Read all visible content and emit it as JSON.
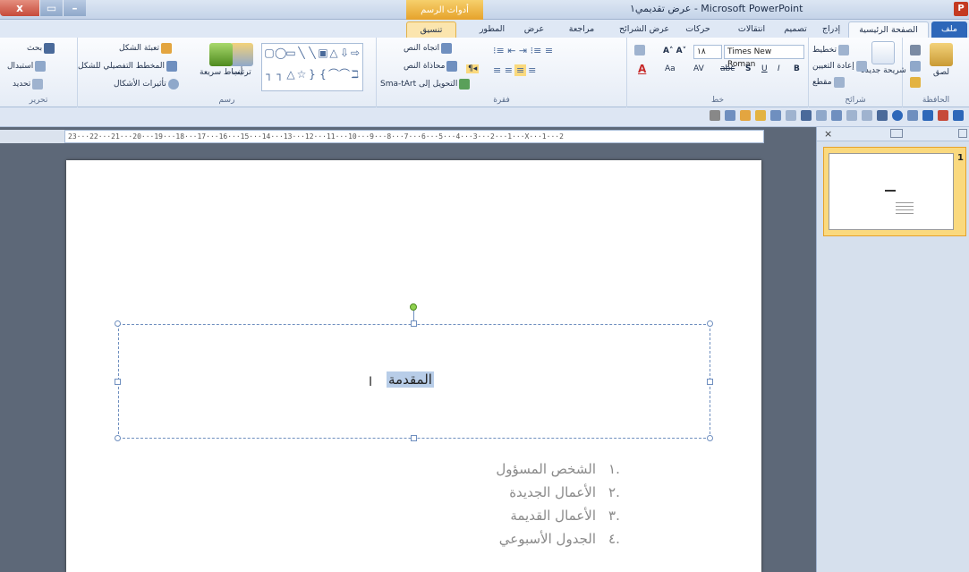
{
  "window": {
    "title": "عرض تقديمي١ - Microsoft PowerPoint",
    "close_label": "x",
    "context_group": "أدوات الرسم",
    "app_icon": "P"
  },
  "tabs": [
    {
      "label": "ملف"
    },
    {
      "label": "الصفحة الرئيسية"
    },
    {
      "label": "إدراج"
    },
    {
      "label": "تصميم"
    },
    {
      "label": "انتقالات"
    },
    {
      "label": "حركات"
    },
    {
      "label": "عرض الشرائح"
    },
    {
      "label": "مراجعة"
    },
    {
      "label": "عرض"
    },
    {
      "label": "المطور"
    },
    {
      "label": "تنسيق"
    }
  ],
  "ribbon": {
    "clipboard": {
      "label": "الحافظة",
      "paste": "لصق"
    },
    "slides": {
      "label": "شرائح",
      "new_slide": "شريحة جديدة",
      "layout": "تخطيط",
      "reset": "إعادة التعيين",
      "section": "مقطع"
    },
    "font": {
      "label": "خط",
      "font_name": "Times New Roman",
      "font_size": "١٨",
      "bold": "B",
      "italic": "I",
      "underline": "U",
      "shadow": "S",
      "strike": "abc",
      "spacing": "AV",
      "case": "Aa",
      "color": "A"
    },
    "paragraph": {
      "label": "فقرة",
      "text_direction": "اتجاه النص",
      "align_text": "محاذاة النص",
      "smartart": "Sma-tArt التحويل إلى"
    },
    "drawing": {
      "label": "رسم",
      "arrange": "ترتيب",
      "quick_styles": "أنماط سريعة",
      "shape_fill": "تعبئة الشكل",
      "shape_outline": "المخطط التفصيلي للشكل",
      "shape_effects": "تأثيرات الأشكال"
    },
    "editing": {
      "label": "تحرير",
      "find": "بحث",
      "replace": "استبدال",
      "select": "تحديد"
    }
  },
  "ruler": {
    "text": "23···22···21···20···19···18···17···16···15···14···13···12···11···10···9···8···7···6···5···4···3···2···1···X···1···2"
  },
  "slide": {
    "title_selected": "المقدمة",
    "cursor_glyph": "I",
    "list": [
      {
        "num": ".١",
        "text": "الشخص المسؤول"
      },
      {
        "num": ".٢",
        "text": "الأعمال الجديدة"
      },
      {
        "num": ".٣",
        "text": "الأعمال القديمة"
      },
      {
        "num": ".٤",
        "text": "الجدول الأسبوعي"
      }
    ]
  },
  "pane": {
    "close_label": "×",
    "slide_number": "1"
  },
  "colors": {
    "file_tab": "#2d67b9",
    "context_tab": "#e6a22b",
    "selection": "#b8cde8",
    "workspace": "#5d6878"
  }
}
